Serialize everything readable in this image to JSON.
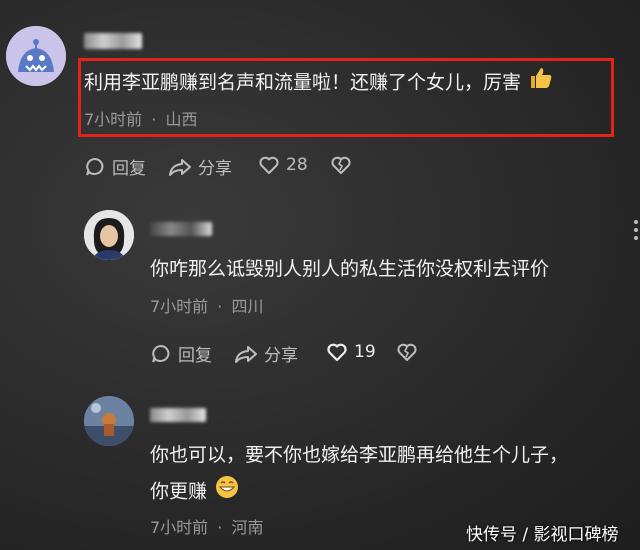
{
  "comments": [
    {
      "text": "利用李亚鹏赚到名声和流量啦！还赚了个女儿，厉害",
      "time": "7小时前",
      "location": "山西",
      "actions": {
        "reply": "回复",
        "share": "分享",
        "likes": "28"
      }
    },
    {
      "text": "你咋那么诋毁别人别人的私生活你没权利去评价",
      "time": "7小时前",
      "location": "四川",
      "actions": {
        "reply": "回复",
        "share": "分享",
        "likes": "19"
      }
    },
    {
      "text_line1": "你也可以，要不你也嫁给李亚鹏再给他生个儿子，",
      "text_line2": "你更赚",
      "time": "7小时前",
      "location": "河南"
    }
  ],
  "separator": "·",
  "watermark": "快传号 / 影视口碑榜",
  "colors": {
    "highlight": "#e2231a",
    "background": "#2e2e2e",
    "meta": "#9a9a9a"
  }
}
